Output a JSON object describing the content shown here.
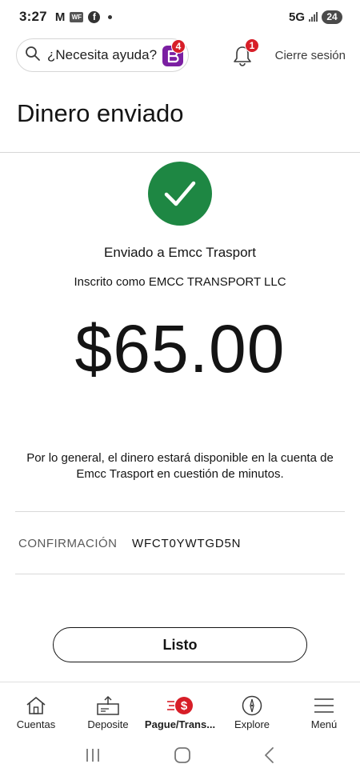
{
  "status_bar": {
    "time": "3:27",
    "network": "5G",
    "battery": "24",
    "notification_icons": [
      "gmail-icon",
      "wf-icon",
      "facebook-icon",
      "dot"
    ]
  },
  "top_bar": {
    "search_label": "¿Necesita ayuda?",
    "assistant_badge_count": "4",
    "notifications_count": "1",
    "signout_label": "Cierre sesión"
  },
  "page": {
    "title": "Dinero enviado"
  },
  "confirmation": {
    "sent_to": "Enviado a Emcc Trasport",
    "enrolled_as": "Inscrito como EMCC TRANSPORT LLC",
    "amount": "$65.00",
    "availability_text": "Por lo general, el dinero estará disponible en la cuenta de Emcc Trasport en cuestión de minutos.",
    "confirmation_label": "CONFIRMACIÓN",
    "confirmation_code": "WFCT0YWTGD5N",
    "done_label": "Listo"
  },
  "bottom_nav": {
    "items": [
      {
        "label": "Cuentas",
        "icon": "home-icon",
        "active": false
      },
      {
        "label": "Deposite",
        "icon": "deposit-icon",
        "active": false
      },
      {
        "label": "Pague/Trans...",
        "icon": "pay-transfer-icon",
        "active": true
      },
      {
        "label": "Explore",
        "icon": "compass-icon",
        "active": false
      },
      {
        "label": "Menú",
        "icon": "menu-icon",
        "active": false
      }
    ]
  },
  "colors": {
    "success_green": "#1e8743",
    "badge_red": "#d71e28",
    "assistant_purple": "#7b1fa2"
  }
}
